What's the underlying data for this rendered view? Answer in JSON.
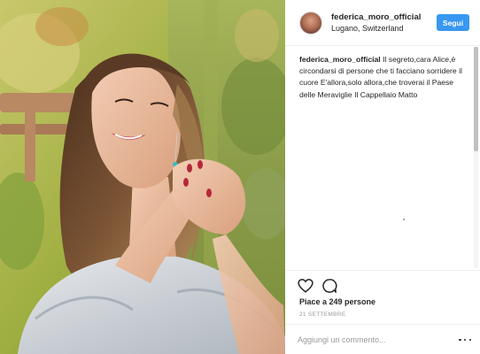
{
  "post": {
    "username": "federica_moro_official",
    "location": "Lugano, Switzerland",
    "follow_label": "Segui",
    "caption_user": "federica_moro_official",
    "caption_text": "Il segreto,cara Alice,è circondarsi di persone che ti facciano sorridere il cuore E'allora,solo allora,che troverai il Paese delle Meraviglie Il Cappellaio Matto",
    "likes": "Piace a 249 persone",
    "date": "21 SETTEMBRE",
    "comment_placeholder": "Aggiungi un commento...",
    "icons": {
      "like": "heart-icon",
      "comment": "comment-icon",
      "more": "more-options-icon"
    }
  },
  "colors": {
    "follow_button": "#3897f0",
    "text": "#262626",
    "muted": "#999999",
    "divider": "#efefef"
  }
}
